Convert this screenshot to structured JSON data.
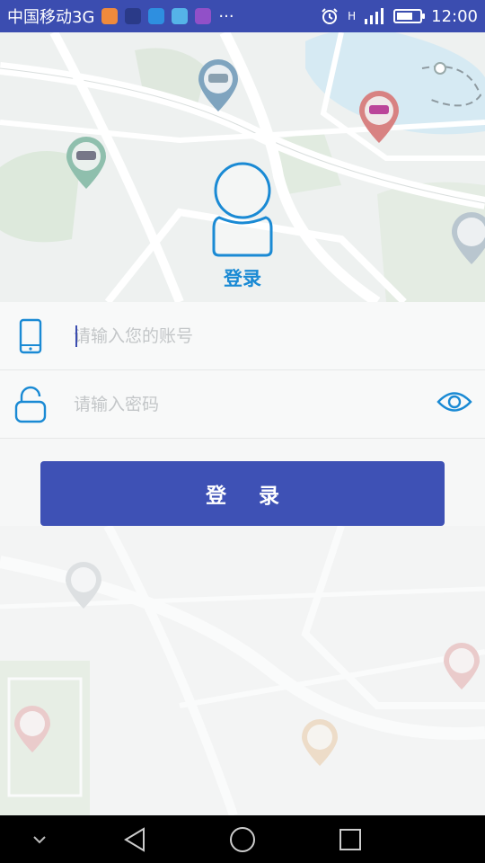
{
  "status_bar": {
    "carrier": "中国移动3G",
    "more": "···",
    "network": "H",
    "time": "12:00",
    "battery_level": 0.7,
    "app_icons": [
      "camera-app-icon",
      "maps-app-icon",
      "message-app-icon",
      "cloud-app-icon",
      "gallery-app-icon"
    ]
  },
  "header": {
    "title": "登录"
  },
  "form": {
    "account": {
      "placeholder": "请输入您的账号",
      "value": ""
    },
    "password": {
      "placeholder": "请输入密码",
      "value": ""
    }
  },
  "login_button": {
    "label": "登 录"
  },
  "colors": {
    "primary": "#3e51b5",
    "accent_blue": "#1a8ad4",
    "status_bar": "#3b4db0",
    "background": "#f6f7f7"
  }
}
